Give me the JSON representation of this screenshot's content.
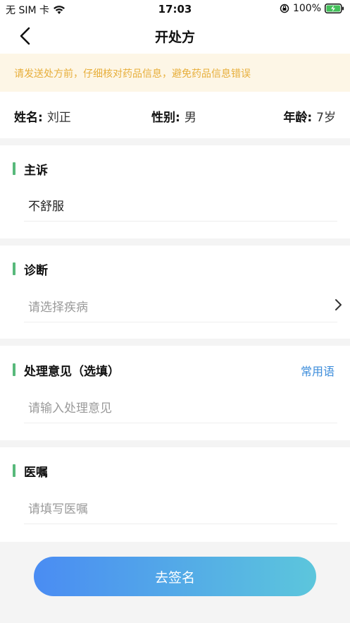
{
  "status_bar": {
    "carrier": "无 SIM 卡",
    "time": "17:03",
    "battery": "100%"
  },
  "nav": {
    "title": "开处方"
  },
  "warning": {
    "text": "请发送处方前，仔细核对药品信息，避免药品信息错误"
  },
  "patient": {
    "name_label": "姓名:",
    "name_value": "刘正",
    "gender_label": "性别:",
    "gender_value": "男",
    "age_label": "年龄:",
    "age_value": "7岁"
  },
  "complaint": {
    "title": "主诉",
    "value": "不舒服"
  },
  "diagnosis": {
    "title": "诊断",
    "placeholder": "请选择疾病"
  },
  "treatment": {
    "title": "处理意见（选填）",
    "common_phrases": "常用语",
    "placeholder": "请输入处理意见"
  },
  "advice": {
    "title": "医嘱",
    "placeholder": "请填写医嘱"
  },
  "actions": {
    "sign_label": "去签名"
  },
  "colors": {
    "accent_green": "#58b97b",
    "link_blue": "#3d8ddb",
    "warning_text": "#e7ae3a",
    "warning_bg": "#fdf6e6",
    "button_gradient_start": "#4a8cf3",
    "button_gradient_end": "#5cc6dc"
  }
}
